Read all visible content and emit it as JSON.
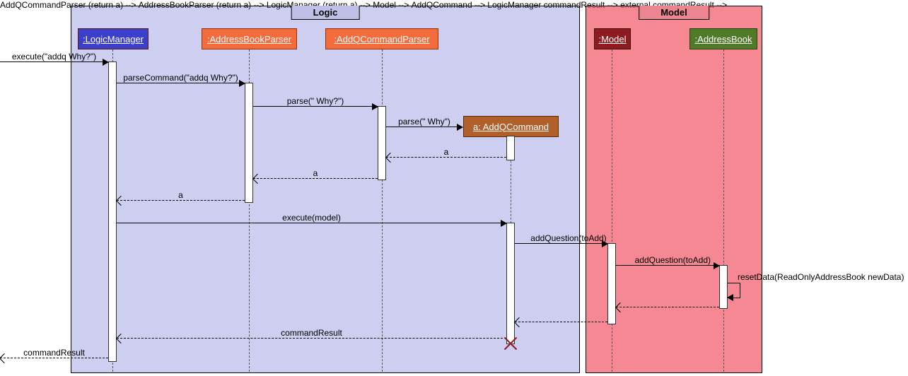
{
  "frames": {
    "logic": {
      "title": "Logic"
    },
    "model": {
      "title": "Model"
    }
  },
  "participants": {
    "logicManager": {
      "label": ":LogicManager"
    },
    "addressBookParser": {
      "label": ":AddressBookParser"
    },
    "addQCommandParser": {
      "label": ":AddQCommandParser"
    },
    "addQCommand": {
      "label": "a: AddQCommand"
    },
    "modelP": {
      "label": ":Model"
    },
    "addressBook": {
      "label": ":AddressBook"
    }
  },
  "messages": {
    "m1": "execute(\"addq Why?\")",
    "m2": "parseCommand(\"addq Why?\")",
    "m3": "parse(\" Why?\")",
    "m4": "parse(\" Why\")",
    "r4": "a",
    "r3": "a",
    "r2": "a",
    "m5": "execute(model)",
    "m6": "addQuestion(toAdd)",
    "m7": "addQuestion(toAdd)",
    "m8": "resetData(ReadOnlyAddressBook newData)",
    "r5": "commandResult",
    "r1": "commandResult"
  }
}
